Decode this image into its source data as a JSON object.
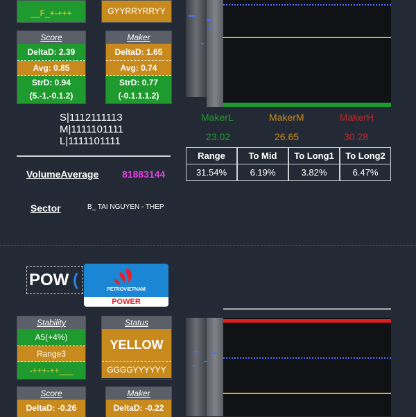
{
  "top": {
    "stability_foot": "__F_+-+++",
    "status_foot": "GYYRRYRRYY"
  },
  "score": {
    "title": "Score",
    "delta": "DeltaD: 2.39",
    "avg": "Avg: 0.85",
    "std": "StrD: 0.94",
    "range": "(5.-1.-0.1.2)"
  },
  "maker": {
    "title": "Maker",
    "delta": "DeltaD: 1.65",
    "avg": "Avg: 0.74",
    "std": "StrD: 0.77",
    "range": "(-0.1.1.1.2)"
  },
  "slm": {
    "s": "S|1112111113",
    "m": "M|1111101111",
    "l": "L|1111101111"
  },
  "volume": {
    "label": "VolumeAverage",
    "value": "81883144"
  },
  "sector": {
    "label": "Sector",
    "value": "B_ TAI NGUYEN - THEP"
  },
  "makers": {
    "low_label": "MakerL",
    "mid_label": "MakerM",
    "high_label": "MakerH",
    "low_value": "23.02",
    "mid_value": "26.65",
    "high_value": "30.28"
  },
  "stats_table": {
    "headers": [
      "Range",
      "To Mid",
      "To Long1",
      "To Long2"
    ],
    "values": [
      "31.54%",
      "6.19%",
      "3.82%",
      "6.47%"
    ]
  },
  "pow": {
    "ticker": "POW",
    "paren": "(",
    "logo_top": "PETROVIETNAM",
    "logo_bottom": "POWER",
    "stability": {
      "title": "Stability",
      "value": "A5(+4%)",
      "range": "Range3",
      "foot": "-+++-++___"
    },
    "status": {
      "title": "Status",
      "value": "YELLOW",
      "foot": "GGGGYYYYYY"
    },
    "score": {
      "title": "Score",
      "delta": "DeltaD: -0.26"
    },
    "maker": {
      "title": "Maker",
      "delta": "DeltaD: -0.22"
    }
  },
  "colors": {
    "green": "#1f9a2e",
    "orange": "#c88a1d",
    "maker_low": "#1f9a2e",
    "maker_mid": "#c88a1d",
    "maker_high": "#c0262b",
    "volume_value": "#e040e0",
    "chart_mid_line": "#e0a830",
    "chart_top_red": "#e01e1e"
  }
}
